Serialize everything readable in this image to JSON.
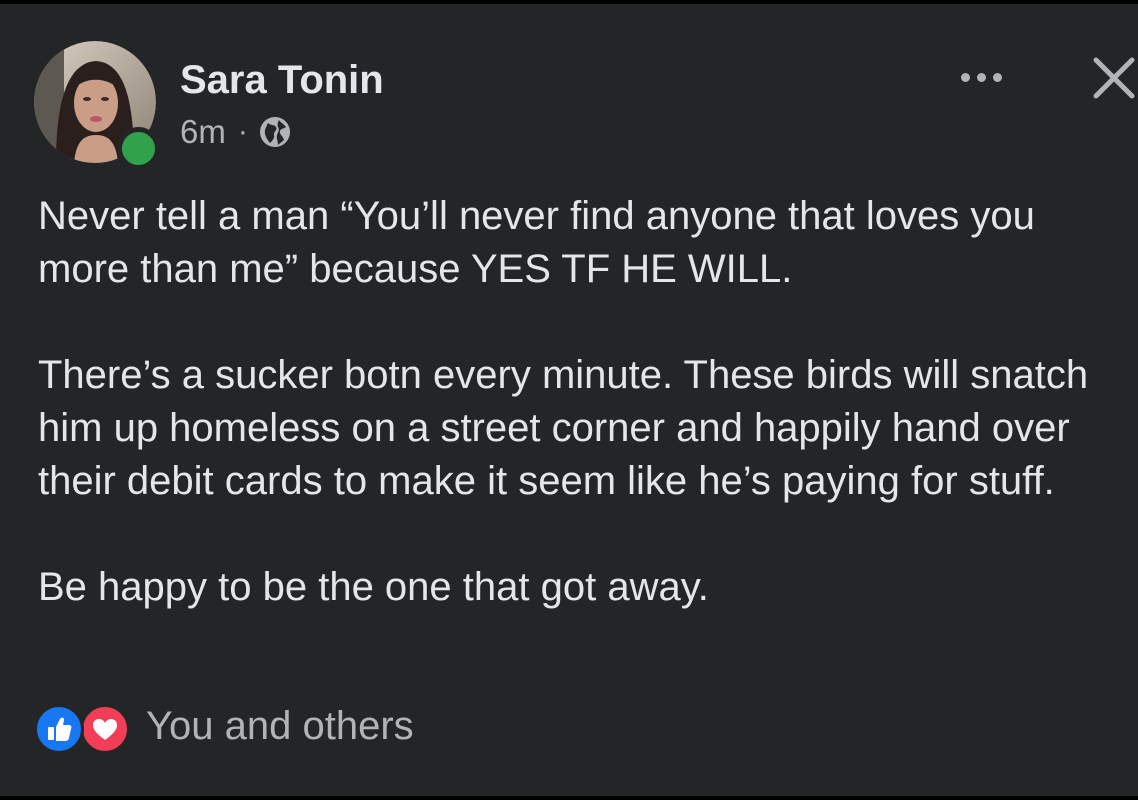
{
  "post": {
    "author": {
      "name": "Sara Tonin",
      "online": true
    },
    "timestamp": "6m",
    "separator": "·",
    "audience_icon": "globe-icon",
    "menu_icon": "more-options-icon",
    "close_icon": "close-icon",
    "paragraphs": [
      "Never tell a man “You’ll never find anyone that loves you more than me” because YES TF HE WILL.",
      "There’s a sucker botn every minute. These birds will snatch him up homeless on a street corner and happily hand over their debit cards to make it seem like he’s paying for stuff.",
      "Be happy to be the one that got away."
    ],
    "reactions": {
      "icons": [
        "like-icon",
        "love-icon"
      ],
      "summary": "You and others"
    }
  },
  "colors": {
    "background": "#242526",
    "text_primary": "#e4e6eb",
    "text_secondary": "#b0b3b8",
    "online": "#31a24c",
    "like": "#1877f2",
    "love": "#f33e58"
  }
}
